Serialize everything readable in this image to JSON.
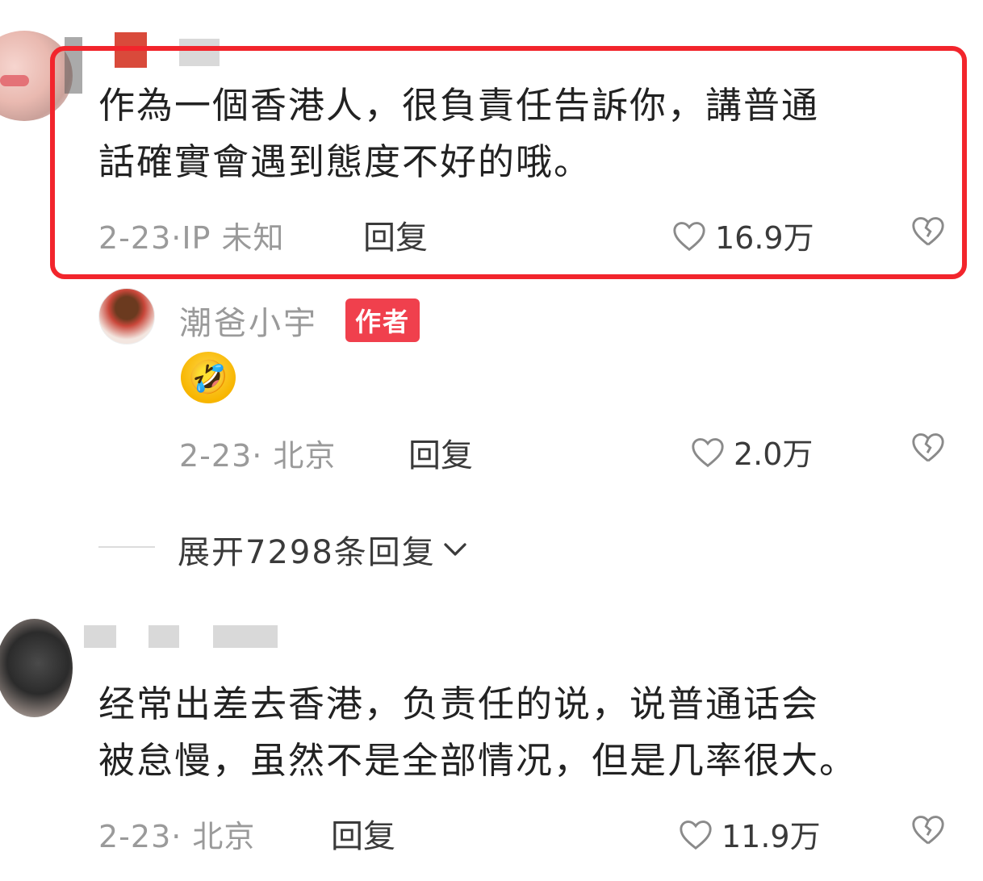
{
  "comments": [
    {
      "text_line1": "作為一個香港人，很負責任告訴你，講普通",
      "text_line2": "話確實會遇到態度不好的哦。",
      "meta": "2-23·IP 未知",
      "reply_label": "回复",
      "likes": "16.9万",
      "highlighted": true
    },
    {
      "text_line1": "经常出差去香港，负责任的说，说普通话会",
      "text_line2": "被怠慢，虽然不是全部情况，但是几率很大。",
      "meta": "2-23· 北京",
      "reply_label": "回复",
      "likes": "11.9万"
    }
  ],
  "author_reply": {
    "name": "潮爸小宇",
    "badge": "作者",
    "emoji": "🤣",
    "meta": "2-23· 北京",
    "reply_label": "回复",
    "likes": "2.0万"
  },
  "expand": {
    "label": "展开7298条回复",
    "icon": "chevron-down-icon"
  },
  "colors": {
    "highlight": "#f2252c",
    "badge": "#f0404d"
  }
}
